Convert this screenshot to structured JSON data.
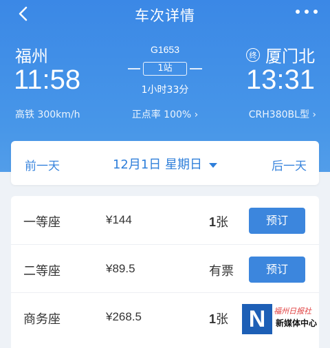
{
  "nav": {
    "title": "车次详情",
    "back_icon": "chevron-left-icon",
    "more_icon": "more-dots-icon"
  },
  "journey": {
    "from_station": "福州",
    "to_station": "厦门北",
    "end_badge": "终",
    "train_no": "G1653",
    "stops": "1站",
    "duration": "1小时33分",
    "dep_time": "11:58",
    "arr_time": "13:31",
    "speed": "高铁 300km/h",
    "punctuality": "正点率 100% ›",
    "model": "CRH380BL型 ›"
  },
  "date_bar": {
    "prev": "前一天",
    "date": "12月1日  星期日",
    "next": "后一天"
  },
  "seats": [
    {
      "name": "一等座",
      "price": "¥144",
      "avail_num": "1",
      "avail_unit": "张",
      "button": "预订"
    },
    {
      "name": "二等座",
      "price": "¥89.5",
      "avail_num": "",
      "avail_unit": "有票",
      "button": "预订"
    },
    {
      "name": "商务座",
      "price": "¥268.5",
      "avail_num": "1",
      "avail_unit": "张",
      "button": ""
    }
  ],
  "watermark": {
    "logo_letter": "N",
    "top": "福州日报社",
    "bottom": "新媒体中心"
  },
  "colors": {
    "header": "#3b88e6",
    "accent": "#3c86dd"
  }
}
